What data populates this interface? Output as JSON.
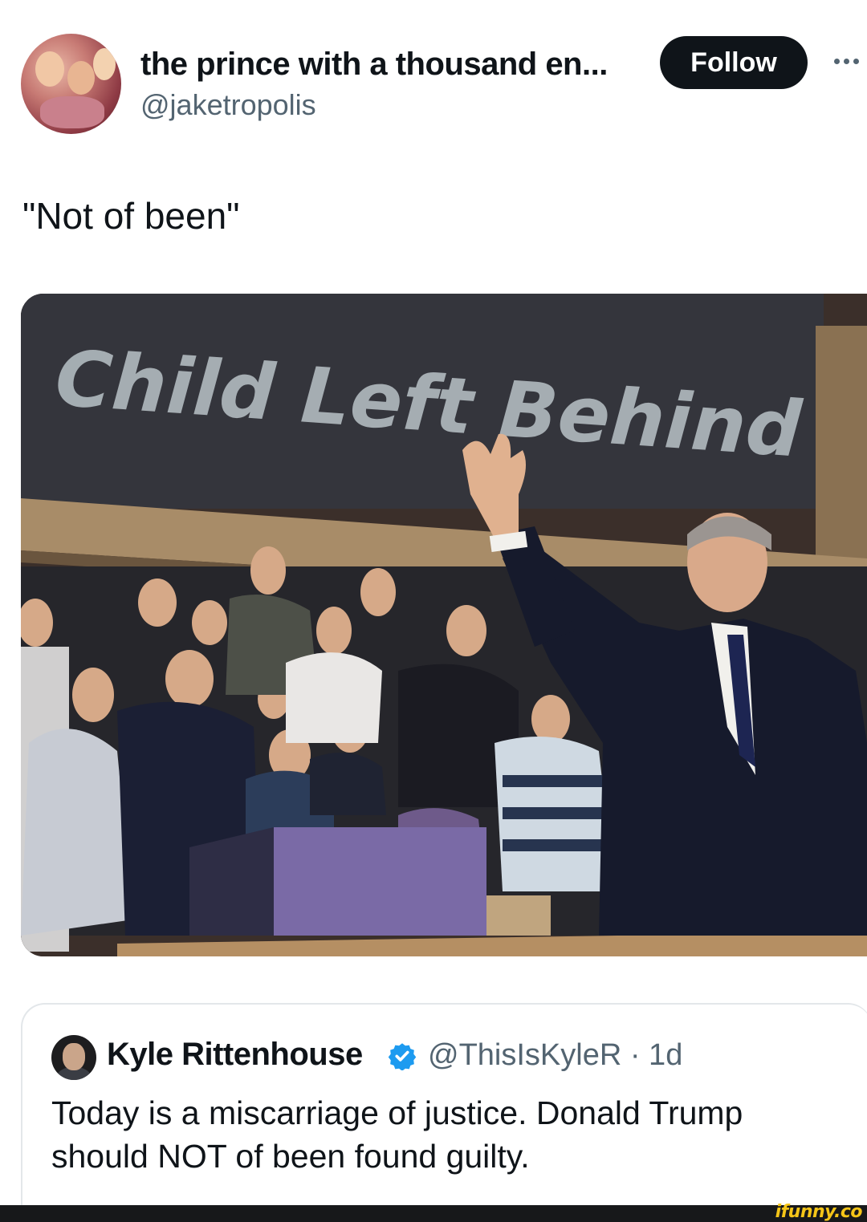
{
  "author": {
    "display_name": "the prince with a thousand en...",
    "handle": "@jaketropolis",
    "follow_label": "Follow"
  },
  "tweet": {
    "text": "\"Not of been\""
  },
  "media": {
    "chalkboard_text": "Child Left Behind"
  },
  "quoted_tweet": {
    "display_name": "Kyle Rittenhouse",
    "handle_and_time": "@ThisIsKyleR · 1d",
    "text": "Today is a miscarriage of justice. Donald Trump should NOT of been found guilty."
  },
  "watermark": {
    "brand": "ifunny.co"
  },
  "colors": {
    "text_primary": "#0f1419",
    "text_secondary": "#536471",
    "follow_bg": "#0f1419",
    "verified_blue": "#1d9bf0",
    "chalkboard": "#34353c",
    "brand_yellow": "#f5c518"
  },
  "icons": [
    "more-icon",
    "verified-badge-icon"
  ]
}
